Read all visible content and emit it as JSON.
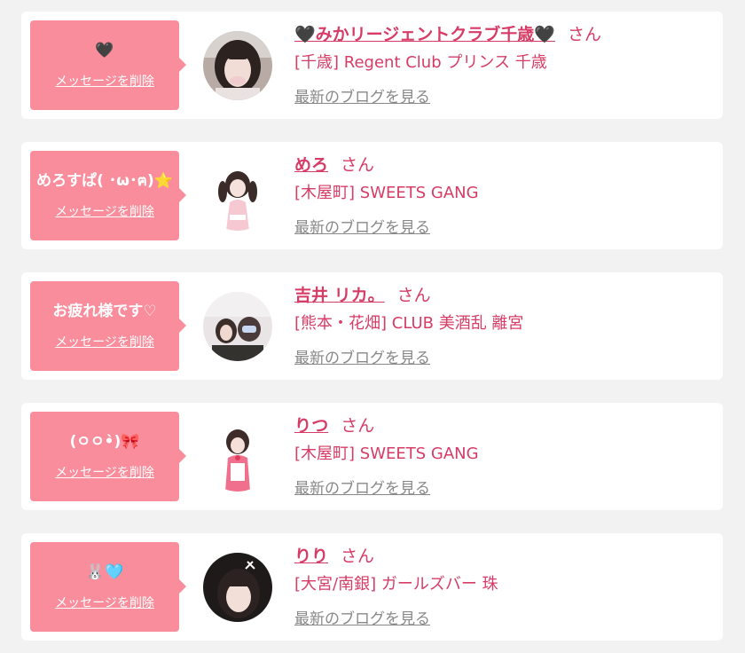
{
  "colors": {
    "page_background": "#f2f2f2",
    "card_background": "#ffffff",
    "bubble_pink": "#f98d9c",
    "accent_text": "#d63c66",
    "link_gray": "#888888"
  },
  "messages": [
    {
      "bubble_text": "🖤",
      "delete_label": "メッセージを削除",
      "name": "🖤みかリージェントクラブ千歳🖤",
      "honorific": "さん",
      "shop": "[千歳] Regent Club プリンス 千歳",
      "blog_link": "最新のブログを見る"
    },
    {
      "bubble_text": "めろすぱ( ･ω･ฅ)⭐",
      "delete_label": "メッセージを削除",
      "name": "めろ",
      "honorific": "さん",
      "shop": "[木屋町] SWEETS GANG",
      "blog_link": "最新のブログを見る"
    },
    {
      "bubble_text": "お疲れ様です♡",
      "delete_label": "メッセージを削除",
      "name": "吉井 リカ。",
      "honorific": "さん",
      "shop": "[熊本・花畑] CLUB 美酒乱 離宮",
      "blog_link": "最新のブログを見る"
    },
    {
      "bubble_text": "(ㅇㅇ•̀)🎀",
      "delete_label": "メッセージを削除",
      "name": "りつ",
      "honorific": "さん",
      "shop": "[木屋町] SWEETS GANG",
      "blog_link": "最新のブログを見る"
    },
    {
      "bubble_text": "🐰🩵",
      "delete_label": "メッセージを削除",
      "name": "りり",
      "honorific": "さん",
      "shop": "[大宮/南銀] ガールズバー 珠",
      "blog_link": "最新のブログを見る"
    }
  ]
}
